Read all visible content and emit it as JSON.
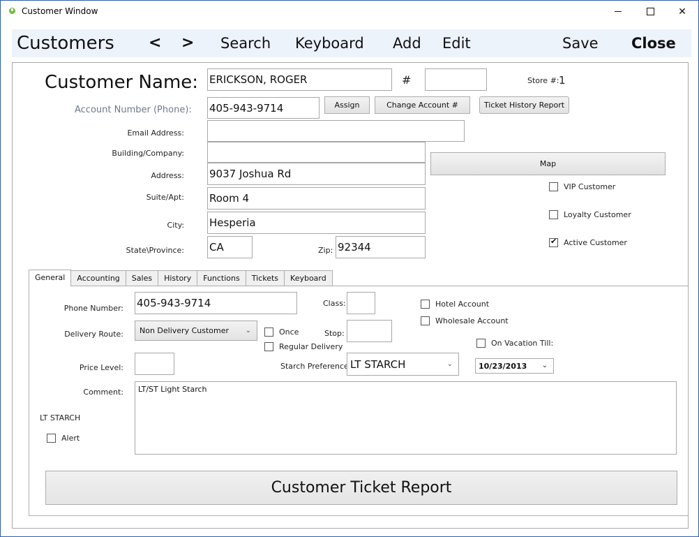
{
  "window": {
    "title": "Customer Window",
    "app_icon": "app-refresh-icon",
    "controls": {
      "minimize": "minimize-icon",
      "maximize": "maximize-icon",
      "close": "close-icon"
    },
    "border_color": "#2b5fa8"
  },
  "toolbar": {
    "title": "Customers",
    "prev_label": "<",
    "next_label": ">",
    "search_label": "Search",
    "keyboard_label": "Keyboard",
    "add_label": "Add",
    "edit_label": "Edit",
    "save_label": "Save",
    "close_label": "Close",
    "background": "#edf3fb"
  },
  "customer": {
    "name_label": "Customer Name:",
    "name_value": "ERICKSON, ROGER",
    "number_label": "#",
    "number_value": "",
    "store_label": "Store #:",
    "store_value": "1",
    "account_label": "Account Number (Phone):",
    "account_value": "405-943-9714",
    "assign_label": "Assign",
    "change_account_label": "Change Account #",
    "ticket_history_label": "Ticket History Report",
    "email_label": "Email Address:",
    "email_value": "",
    "building_label": "Building/Company:",
    "building_value": "",
    "address_label": "Address:",
    "address_value": "9037 Joshua Rd",
    "suite_label": "Suite/Apt:",
    "suite_value": "Room 4",
    "city_label": "City:",
    "city_value": "Hesperia",
    "state_label": "State\\Province:",
    "state_value": "CA",
    "zip_label": "Zip:",
    "zip_value": "92344",
    "map_label": "Map",
    "flags": [
      {
        "label": "VIP Customer",
        "checked": false
      },
      {
        "label": "Loyalty Customer",
        "checked": false
      },
      {
        "label": "Active Customer",
        "checked": true
      }
    ]
  },
  "tabs": [
    {
      "label": "General",
      "active": true
    },
    {
      "label": "Accounting",
      "active": false
    },
    {
      "label": "Sales",
      "active": false
    },
    {
      "label": "History",
      "active": false
    },
    {
      "label": "Functions",
      "active": false
    },
    {
      "label": "Tickets",
      "active": false
    },
    {
      "label": "Keyboard",
      "active": false
    }
  ],
  "general": {
    "phone_label": "Phone Number:",
    "phone_value": "405-943-9714",
    "class_label": "Class:",
    "class_value": "",
    "hotel_label": "Hotel Account",
    "hotel_checked": false,
    "wholesale_label": "Wholesale Account",
    "wholesale_checked": false,
    "route_label": "Delivery Route:",
    "route_value": "Non Delivery Customer",
    "once_label": "Once",
    "once_checked": false,
    "regular_label": "Regular Delivery",
    "regular_checked": false,
    "stop_label": "Stop:",
    "stop_value": "",
    "vacation_label": "On Vacation Till:",
    "vacation_checked": false,
    "vacation_date": "10/23/2013",
    "price_label": "Price Level:",
    "price_value": "",
    "starch_label": "Starch Preference:",
    "starch_value": "LT STARCH",
    "comment_label": "Comment:",
    "comment_value": "LT/ST Light Starch",
    "starch_note": "LT STARCH",
    "alert_label": "Alert",
    "alert_checked": false,
    "report_label": "Customer Ticket Report"
  }
}
